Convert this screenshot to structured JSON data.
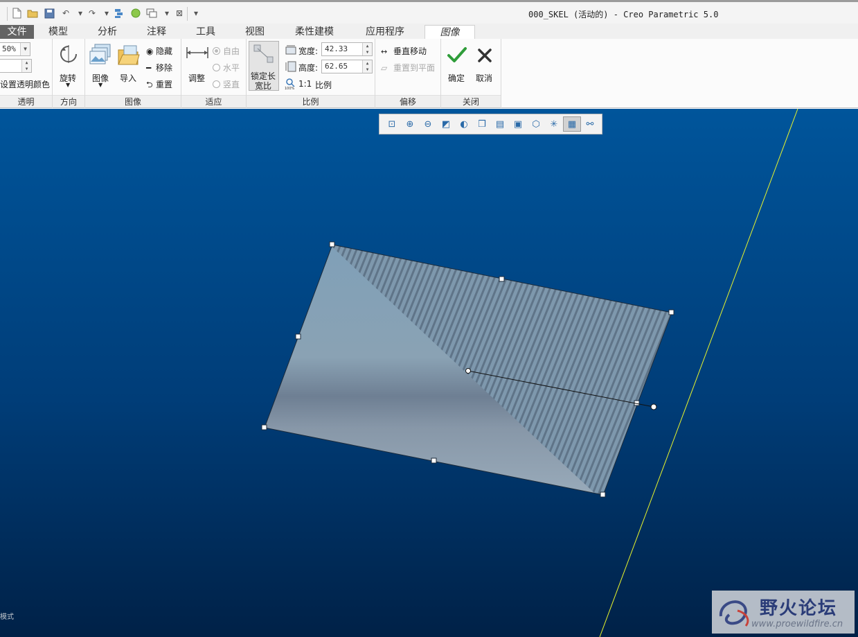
{
  "window": {
    "title": "000_SKEL (活动的) - Creo Parametric 5.0"
  },
  "tabs": [
    {
      "label": "文件"
    },
    {
      "label": "模型"
    },
    {
      "label": "分析"
    },
    {
      "label": "注释"
    },
    {
      "label": "工具"
    },
    {
      "label": "视图"
    },
    {
      "label": "柔性建模"
    },
    {
      "label": "应用程序"
    },
    {
      "label": "图像"
    }
  ],
  "ribbon": {
    "transparency": {
      "value": "50%",
      "set_color_label": "设置透明颜色",
      "group_label": "透明"
    },
    "direction": {
      "rotate_label": "旋转",
      "group_label": "方向"
    },
    "image": {
      "image_label": "图像",
      "import_label": "导入",
      "hide_label": "隐藏",
      "remove_label": "移除",
      "reset_label": "重置",
      "group_label": "图像"
    },
    "fit": {
      "adjust_label": "调整",
      "free_label": "自由",
      "horizontal_label": "水平",
      "vertical_label": "竖直",
      "group_label": "适应"
    },
    "scale": {
      "lock_line1": "锁定长",
      "lock_line2": "宽比",
      "width_label": "宽度:",
      "width_value": "42.33",
      "height_label": "高度:",
      "height_value": "62.65",
      "ratio_label": "1:1",
      "scale_label": "比例",
      "group_label": "比例"
    },
    "offset": {
      "move_label": "垂直移动",
      "reset_plane_label": "重置到平面",
      "group_label": "偏移"
    },
    "close": {
      "ok_label": "确定",
      "cancel_label": "取消",
      "group_label": "关闭"
    }
  },
  "view_toolbar": {
    "icons": [
      "refit-icon",
      "zoom-in-icon",
      "zoom-out-icon",
      "repaint-icon",
      "display-style-icon",
      "saved-views-icon",
      "view-manager-icon",
      "perspective-icon",
      "section-icon",
      "datum-display-icon",
      "annotation-display-icon",
      "spin-center-icon"
    ]
  },
  "status": {
    "mode_text": "模式"
  },
  "watermark": {
    "title": "野火论坛",
    "url": "www.proewildfire.cn"
  },
  "colors": {
    "accent_green": "#2f9d3a",
    "cancel_dark": "#333333",
    "datum_line": "#e9f52a"
  }
}
